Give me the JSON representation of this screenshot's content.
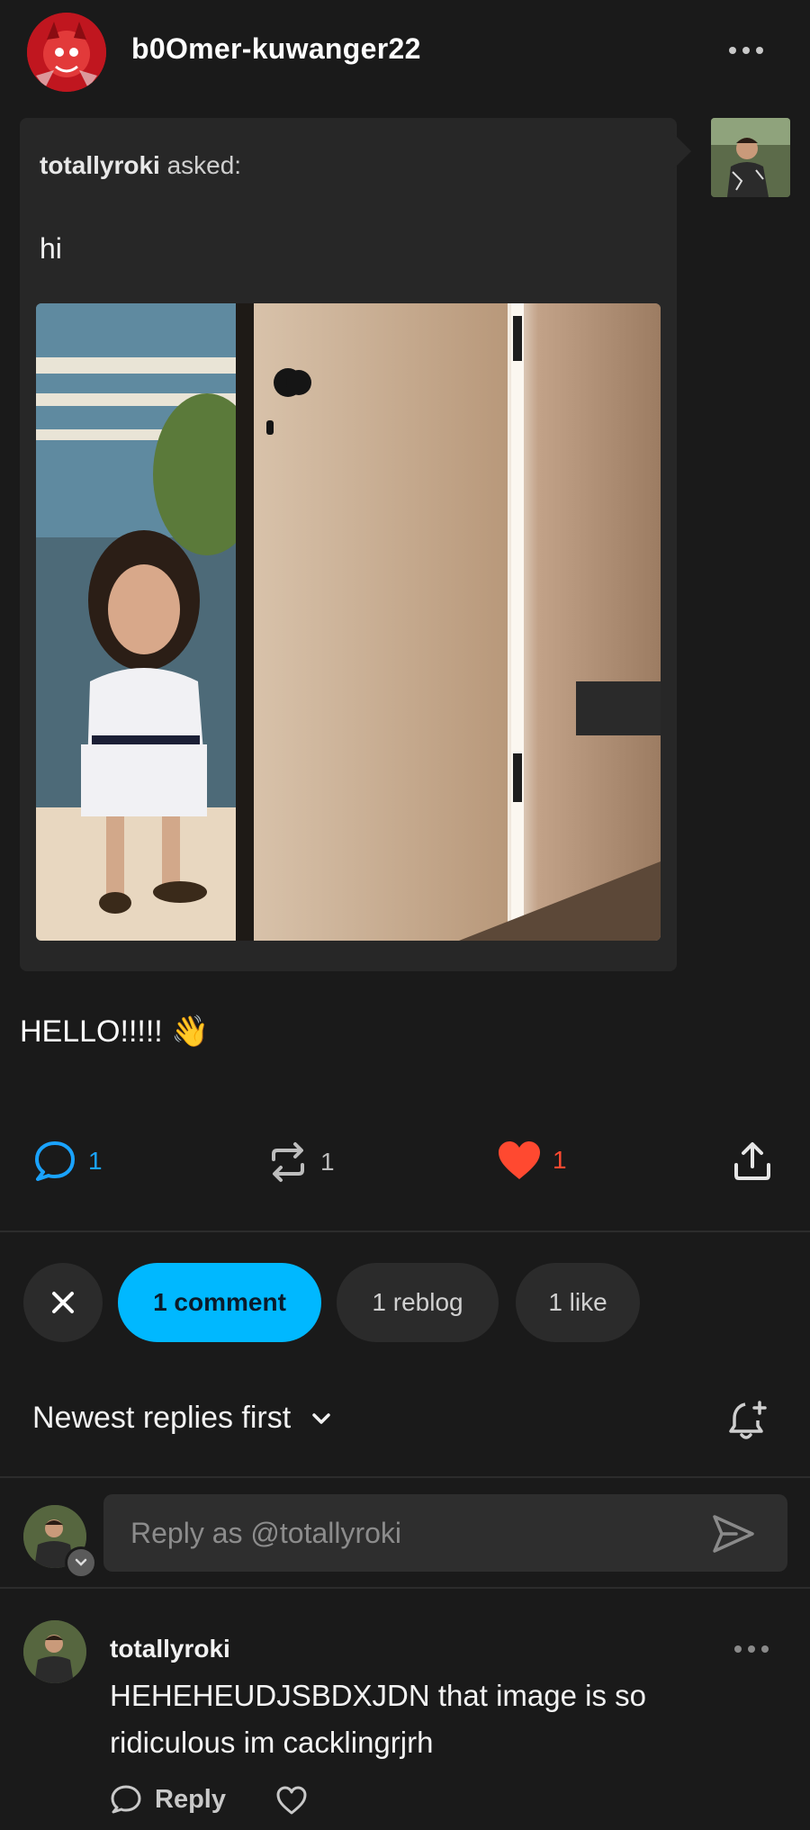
{
  "header": {
    "blog_name": "b0Omer-kuwanger22"
  },
  "ask": {
    "asker": "totallyroki",
    "asked_suffix": " asked:",
    "question": "hi"
  },
  "answer": {
    "text": "HELLO!!!!! 👋"
  },
  "actions": {
    "comments": "1",
    "reblogs": "1",
    "likes": "1"
  },
  "tabs": {
    "comment_label": "1 comment",
    "reblog_label": "1 reblog",
    "like_label": "1 like"
  },
  "sort": {
    "label": "Newest replies first"
  },
  "reply": {
    "placeholder": "Reply as @totallyroki"
  },
  "comment": {
    "author": "totallyroki",
    "text": "HEHEHEUDJSBDXJDN that image is so ridiculous im cacklingrjrh",
    "reply_label": "Reply"
  },
  "colors": {
    "accent": "#00b8ff",
    "like": "#ff4930",
    "comment_icon": "#1aa3ff",
    "background": "#1a1a1a"
  }
}
